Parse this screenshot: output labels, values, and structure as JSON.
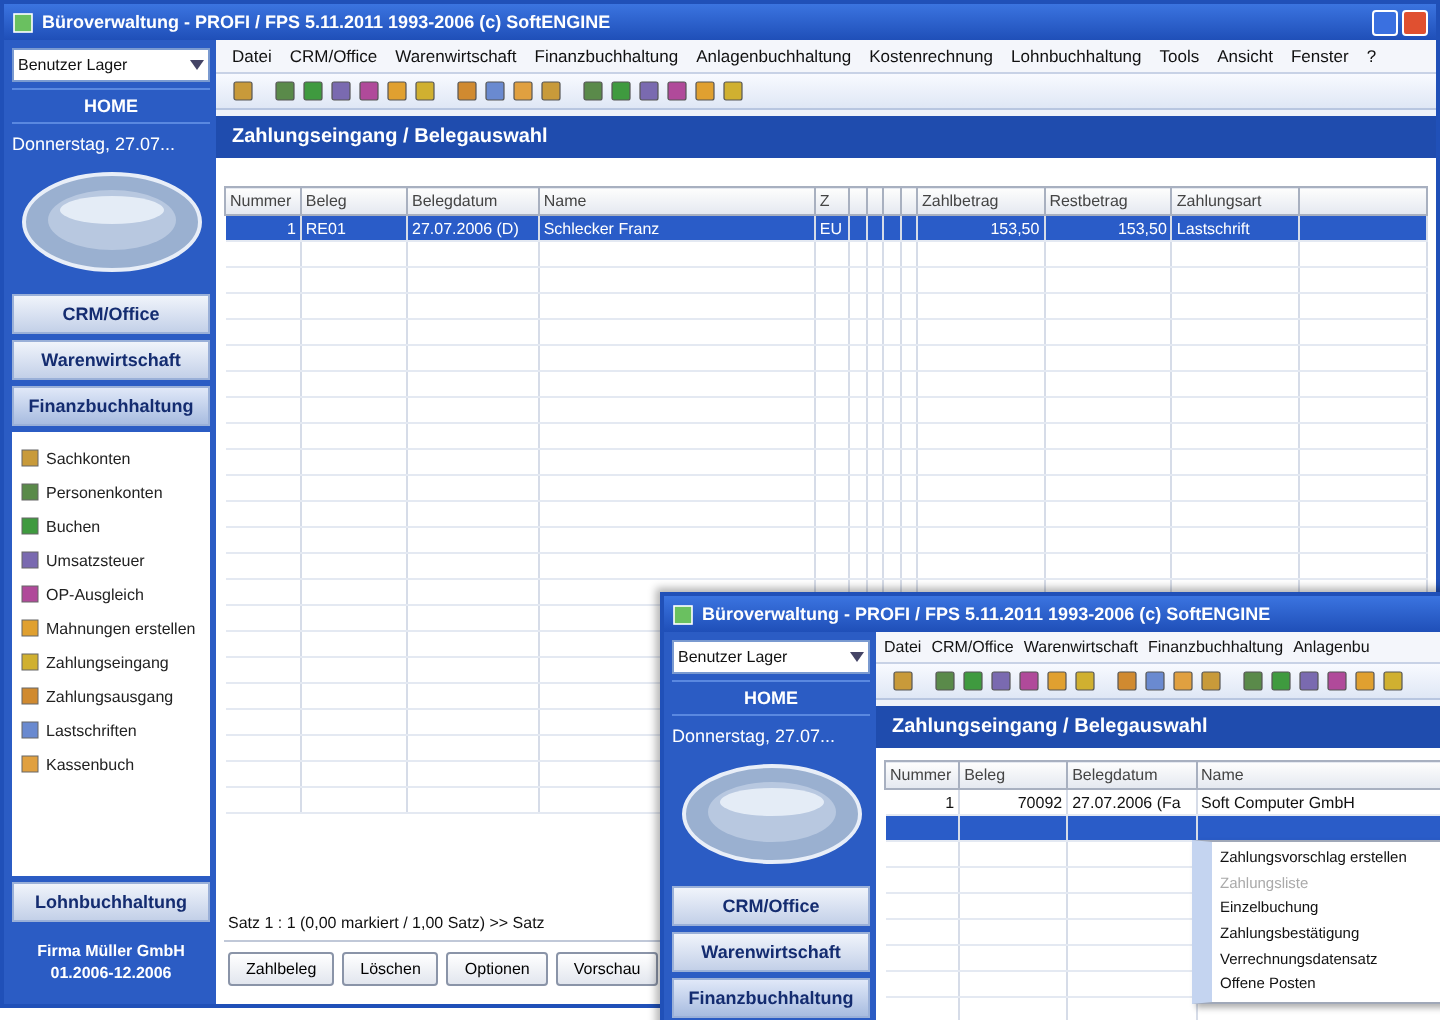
{
  "windows": [
    {
      "title": "Büroverwaltung - PROFI / FPS 5.11.2011 1993-2006 (c) SoftENGINE",
      "user_select": {
        "value": "Benutzer Lager"
      },
      "home": "HOME",
      "date": "Donnerstag, 27.07...",
      "sections": [
        {
          "label": "CRM/Office",
          "selected": false
        },
        {
          "label": "Warenwirtschaft",
          "selected": false
        },
        {
          "label": "Finanzbuchhaltung",
          "selected": true
        }
      ],
      "items": [
        "Sachkonten",
        "Personenkonten",
        "Buchen",
        "Umsatzsteuer",
        "OP-Ausgleich",
        "Mahnungen erstellen",
        "Zahlungseingang",
        "Zahlungsausgang",
        "Lastschriften",
        "Kassenbuch"
      ],
      "footer_section": {
        "label": "Lohnbuchhaltung",
        "selected": false
      },
      "company": "Firma Müller GmbH 01.2006-12.2006",
      "menu": [
        "Datei",
        "CRM/Office",
        "Warenwirtschaft",
        "Finanzbuchhaltung",
        "Anlagenbuchhaltung",
        "Kostenrechnung",
        "Lohnbuchhaltung",
        "Tools",
        "Ansicht",
        "Fenster",
        "?"
      ],
      "panel_title": "Zahlungseingang / Belegauswahl",
      "columns": [
        "Nummer",
        "Beleg",
        "Belegdatum",
        "Name",
        "Z",
        null,
        null,
        null,
        null,
        "Zahlbetrag",
        "Restbetrag",
        "Zahlungsart",
        null
      ],
      "rows": [
        {
          "selected": true,
          "cells": [
            "1",
            "RE01",
            "27.07.2006 (D)",
            "Schlecker Franz",
            "EU",
            null,
            null,
            null,
            null,
            "153,50",
            "153,50",
            "Lastschrift",
            null
          ]
        }
      ],
      "status": "Satz 1 : 1 (0,00 markiert / 1,00 Satz) >> Satz",
      "buttons": [
        "Zahlbeleg",
        "Löschen",
        "Optionen",
        "Vorschau"
      ]
    },
    {
      "title": "Büroverwaltung - PROFI / FPS 5.11.2011 1993-2006 (c) SoftENGINE",
      "user_select": {
        "value": "Benutzer Lager"
      },
      "home": "HOME",
      "date": "Donnerstag, 27.07...",
      "sections": [
        {
          "label": "CRM/Office",
          "selected": false
        },
        {
          "label": "Warenwirtschaft",
          "selected": false
        },
        {
          "label": "Finanzbuchhaltung",
          "selected": true
        }
      ],
      "menu": [
        "Datei",
        "CRM/Office",
        "Warenwirtschaft",
        "Finanzbuchhaltung",
        "Anlagenbu"
      ],
      "panel_title": "Zahlungseingang / Belegauswahl",
      "columns": [
        "Nummer",
        "Beleg",
        "Belegdatum",
        "Name"
      ],
      "rows": [
        {
          "selected": false,
          "cells": [
            "1",
            "70092",
            "27.07.2006 (Fa",
            "Soft Computer GmbH"
          ]
        },
        {
          "selected": true,
          "cells": []
        }
      ],
      "context_menu": [
        {
          "label": "Zahlungsvorschlag erstellen",
          "disabled": false
        },
        {
          "label": "Zahlungsliste",
          "disabled": true
        },
        {
          "label": "Einzelbuchung",
          "disabled": false
        },
        {
          "label": "Zahlungsbestätigung",
          "disabled": false
        },
        {
          "label": "Verrechnungsdatensatz",
          "disabled": false
        },
        {
          "label": "Offene Posten",
          "disabled": false
        }
      ]
    }
  ]
}
